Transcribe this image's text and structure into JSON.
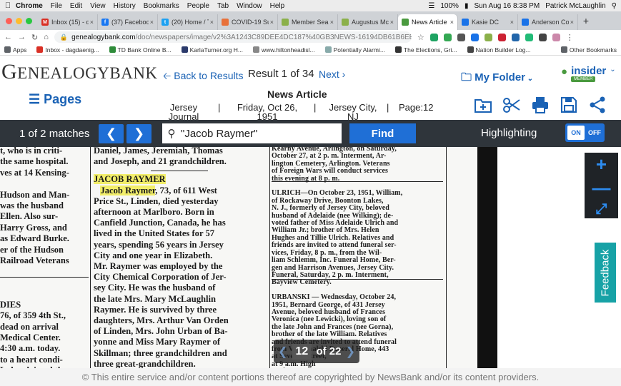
{
  "menubar": {
    "items": [
      "Chrome",
      "File",
      "Edit",
      "View",
      "History",
      "Bookmarks",
      "People",
      "Tab",
      "Window",
      "Help"
    ],
    "battery": "100%",
    "datetime": "Sun Aug 16  8:38 PM",
    "user": "Patrick McLaughlin"
  },
  "tabs": [
    {
      "title": "Inbox (15) - d",
      "color": "#d93025",
      "glyph": "M"
    },
    {
      "title": "(37) Faceboo",
      "color": "#1877f2",
      "glyph": "f"
    },
    {
      "title": "(20) Home / T",
      "color": "#1da1f2",
      "glyph": "t"
    },
    {
      "title": "COVID-19 Su",
      "color": "#e8713a",
      "glyph": ""
    },
    {
      "title": "Member Sear",
      "color": "#8bb04a",
      "glyph": ""
    },
    {
      "title": "Augustus Mc",
      "color": "#8bb04a",
      "glyph": ""
    },
    {
      "title": "News Article",
      "color": "#4a9a3f",
      "glyph": "",
      "active": true
    },
    {
      "title": "Kasie DC",
      "color": "#1a73e8",
      "glyph": ""
    },
    {
      "title": "Anderson Co",
      "color": "#1a73e8",
      "glyph": ""
    }
  ],
  "address": {
    "host": "genealogybank.com",
    "path": "/doc/newspapers/image/v2%3A1243C89DEE4DC187%40GB3NEWS-16194DB61B6EEB0..."
  },
  "bookmarks": [
    {
      "label": "Apps",
      "color": "#5f6368"
    },
    {
      "label": "Inbox - dagdaenig...",
      "color": "#d93025"
    },
    {
      "label": "TD Bank Online B...",
      "color": "#2e8b3a"
    },
    {
      "label": "KarlaTurner.org H...",
      "color": "#2b3a6b"
    },
    {
      "label": "www.hiltonheadisl...",
      "color": "#888"
    },
    {
      "label": "Potentially Alarmi...",
      "color": "#8aa"
    },
    {
      "label": "The Elections, Gri...",
      "color": "#333"
    },
    {
      "label": "Nation Builder Log...",
      "color": "#444"
    },
    {
      "label": "Other Bookmarks",
      "color": "#5f6368"
    }
  ],
  "header": {
    "logo_first": "G",
    "logo_rest": "ENEALOGY",
    "logo_bank": "BANK",
    "back_label": "Back to Results",
    "result_label": "Result 1 of 34",
    "next_label": "Next",
    "my_folder_label": "My Folder",
    "insider_label": "insider",
    "insider_badge": "MEMBER",
    "pages_label": "Pages"
  },
  "article": {
    "heading": "News Article",
    "publication": "Jersey Journal",
    "date": "Friday, Oct 26, 1951",
    "location": "Jersey City, NJ",
    "page": "Page:12",
    "sep": "|"
  },
  "search": {
    "matches_label": "1 of 2 matches",
    "query": "\"Jacob Raymer\"",
    "find_label": "Find",
    "highlighting_label": "Highlighting",
    "toggle_on": "ON",
    "toggle_off": "OFF"
  },
  "newspaper": {
    "col_a": [
      "t, who is in criti-",
      "the same hospital.",
      "ves at 14 Kensing-",
      "",
      "Hudson and Man-",
      "was the husband",
      "Ellen.  Also sur-",
      "Harry Gross, and",
      "as Edward Burke.",
      "er of the Hudson",
      "Railroad Veterans",
      "",
      "",
      "",
      "DIES",
      "76, of 359 4th St.,",
      "dead on arrival",
      "Medical Center.",
      "4:30 a.m. today.",
      "to a heart condi-",
      "Lulu, claimed the"
    ],
    "col_b_top": [
      "Daniel, James, Jeremiah, Thomas",
      "and Joseph, and 21 grandchildren."
    ],
    "col_b_heading": "JACOB RAYMER",
    "col_b_name": "Jacob Raymer",
    "col_b_first_rest": ", 73, of 611 West",
    "col_b_body": [
      "Price St., Linden, died yesterday",
      "afternoon at Marlboro.  Born in",
      "Canfield Junction, Canada, he has",
      "lived in the United States for 57",
      "years, spending 56 years in Jersey",
      "City and one year in Elizabeth.",
      "   Mr. Raymer was employed by the",
      "City Chemical Corporation of Jer-",
      "sey City.  He was the husband of",
      "the late Mrs. Mary McLaughlin",
      "Raymer.  He is survived by three",
      "daughters, Mrs. Arthur Van Orden",
      "of Linden, Mrs. John Urban of Ba-",
      "yonne and Miss Mary Raymer of",
      "Skillman; three grandchildren and",
      "three great-grandchildren."
    ],
    "col_c": [
      "Kearny Avenue, Arlington, on Saturday,",
      "October 27, at 2 p. m.  Interment, Ar-",
      "lington Cemetery, Arlington.  Veterans",
      "of Foreign Wars will conduct services",
      "this evening at 8 p. m.",
      "",
      "ULRICH—On October 23, 1951, William,",
      "of Rockaway Drive, Boonton Lakes,",
      "N. J., formerly of Jersey City, beloved",
      "husband of Adelaide (nee Wilking); de-",
      "voted father of Miss Adelaide Ulrich and",
      "William Jr.; brother of Mrs. Helen",
      "Hughes and Tillie Ulrich.  Relatives and",
      "friends are invited to attend funeral ser-",
      "vices, Friday, 8 p. m., from the Wil-",
      "liam Schlemm, Inc. Funeral Home, Ber-",
      "gen and Harrison Avenues, Jersey City.",
      "Funeral, Saturday, 2 p. m.  Interment,",
      "Bayview Cemetery.",
      "",
      "URBANSKI — Wednesday, October 24,",
      "1951, Bernard George, of 431 Jersey",
      "Avenue, beloved husband of Frances",
      "Veronica (nee Lewicki), loving son of",
      "the late John and Frances (nee Gorna),",
      "brother of the late William.  Relatives",
      "and friends are invited to attend funeral",
      "from V. Michalski Funeral Home, 443",
      "                        at Seventh Street,",
      "                        at 9 a.m. High",
      "                        Anthony's Roman",
      "                        Church, 9:30 a. m."
    ]
  },
  "pager": {
    "current": "12",
    "of_label": "of 22"
  },
  "feedback_label": "Feedback",
  "footer_text": "© This entire service and/or content portions thereof are copyrighted by NewsBank and/or its content providers."
}
